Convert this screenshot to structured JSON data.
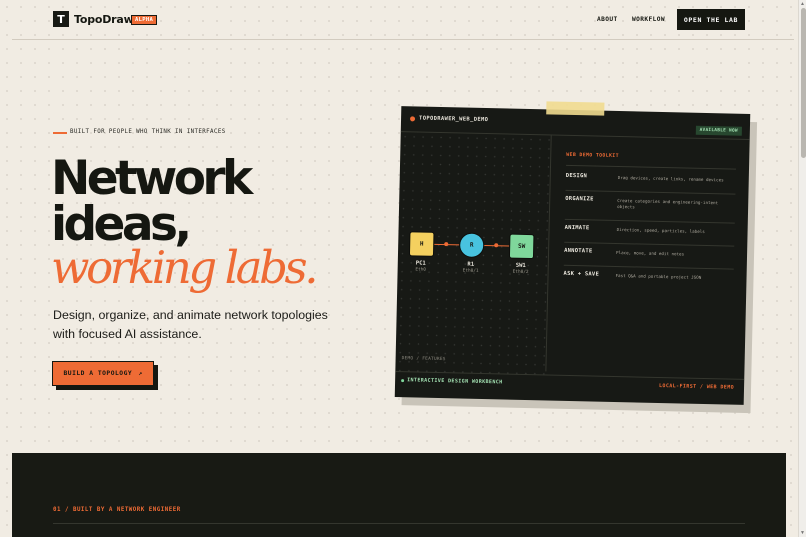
{
  "header": {
    "logo_letter": "T",
    "brand": "TopoDrawer",
    "badge": "ALPHA",
    "nav": [
      {
        "label": "ABOUT"
      },
      {
        "label": "WORKFLOW"
      }
    ],
    "cta": "OPEN THE LAB"
  },
  "hero": {
    "eyebrow": "BUILT FOR PEOPLE WHO THINK IN INTERFACES",
    "title_line1": "Network",
    "title_line2": "ideas,",
    "title_line3": "working labs.",
    "lede": "Design, organize, and animate network topologies with focused AI assistance.",
    "cta_label": "BUILD A TOPOLOGY",
    "cta_icon": "↗"
  },
  "demo": {
    "title": "TOPODRAWER_WEB_DEMO",
    "status": "AVAILABLE NOW",
    "canvas_label": "DEMO / FEATURES",
    "nodes": [
      {
        "glyph": "H",
        "name": "PC1",
        "port": "Eth0",
        "color": "#f4d05f"
      },
      {
        "glyph": "R",
        "name": "R1",
        "port": "Eth0/1",
        "color": "#48c3df"
      },
      {
        "glyph": "SW",
        "name": "SW1",
        "port": "Eth0/2",
        "color": "#7fd79b"
      }
    ],
    "toolkit_title": "WEB DEMO TOOLKIT",
    "features": [
      {
        "name": "DESIGN",
        "desc": "Drag devices, create links, rename devices"
      },
      {
        "name": "ORGANIZE",
        "desc": "Create categories and engineering-intent objects"
      },
      {
        "name": "ANIMATE",
        "desc": "Direction, speed, particles, labels"
      },
      {
        "name": "ANNOTATE",
        "desc": "Place, move, and edit notes"
      },
      {
        "name": "ASK + SAVE",
        "desc": "Fast Q&A and portable project JSON"
      }
    ],
    "footer_left": "INTERACTIVE DESIGN WORKBENCH",
    "footer_right": "LOCAL-FIRST / WEB DEMO"
  },
  "section": {
    "label": "01 / BUILT BY A NETWORK ENGINEER"
  },
  "colors": {
    "accent": "#ee6b35",
    "background": "#f1ece3",
    "dark": "#181a14",
    "green": "#a4e2b3"
  }
}
